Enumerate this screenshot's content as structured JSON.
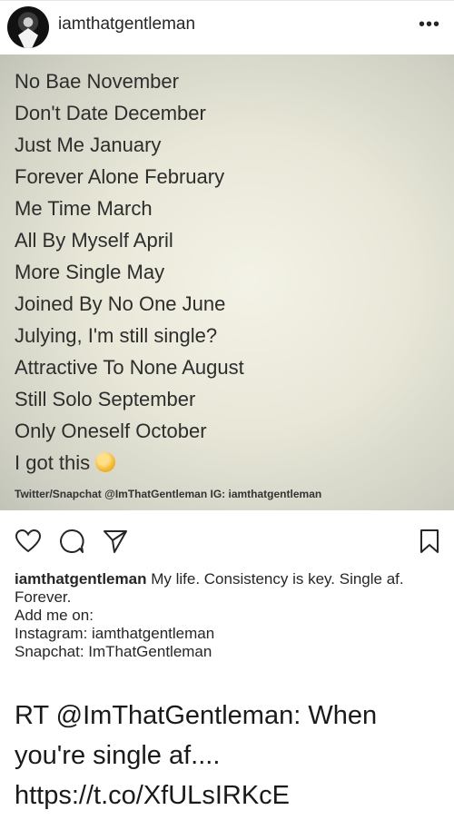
{
  "header": {
    "username": "iamthatgentleman",
    "more_icon": "more-options-icon",
    "more_glyph": "•••"
  },
  "post_image": {
    "lines": [
      "No Bae November",
      "Don't Date December",
      "Just Me January",
      "Forever Alone February",
      "Me Time March",
      "All By Myself April",
      "More Single May",
      "Joined By No One June",
      "Julying, I'm still single?",
      "Attractive To None August",
      "Still Solo September",
      "Only Oneself October",
      "I got this"
    ],
    "emoji": "ok-hand-emoji",
    "credit": "Twitter/Snapchat @ImThatGentleman IG: iamthatgentleman"
  },
  "actions": {
    "like_icon": "heart-icon",
    "comment_icon": "comment-icon",
    "share_icon": "send-icon",
    "save_icon": "bookmark-icon"
  },
  "caption": {
    "username": "iamthatgentleman",
    "text": " My life. Consistency is key. Single af. Forever.",
    "line2": "Add me on:",
    "line3": "Instagram: iamthatgentleman",
    "line4": "Snapchat: ImThatGentleman"
  },
  "tweet": {
    "text": "RT @ImThatGentleman: When you're single af.... https://t.co/XfULsIRKcE"
  },
  "colors": {
    "background": "#ffffff",
    "text": "#262626",
    "image_bg": "#e8e7d8"
  }
}
